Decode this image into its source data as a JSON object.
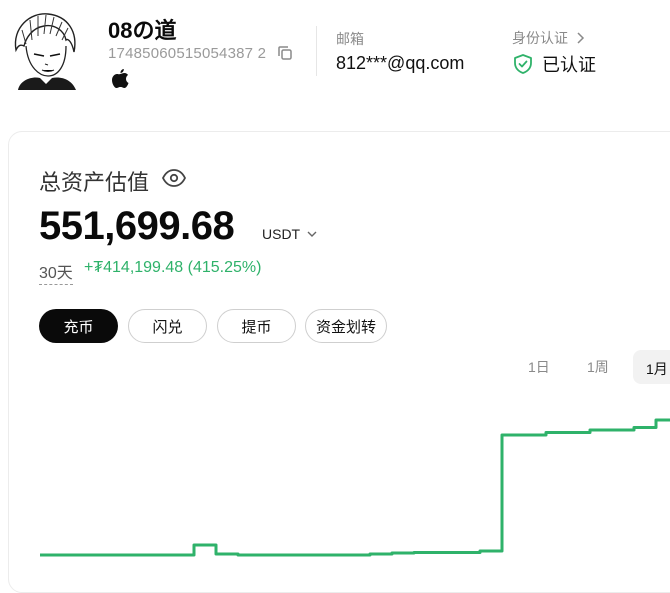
{
  "header": {
    "username": "08の道",
    "uid": "17485060515054387 2",
    "email_label": "邮箱",
    "email_value": "812***@qq.com",
    "kyc_label": "身份认证",
    "kyc_status": "已认证"
  },
  "assets": {
    "title": "总资产估值",
    "total_value": "551,699.68",
    "currency": "USDT",
    "period": "30天",
    "pnl": "+₮414,199.48 (415.25%)"
  },
  "actions": {
    "deposit": "充币",
    "convert": "闪兑",
    "withdraw": "提币",
    "transfer": "资金划转"
  },
  "ranges": {
    "day": "1日",
    "week": "1周",
    "month": "1月"
  },
  "colors": {
    "accent_green": "#2fb26a",
    "primary_button": "#0a0a0a"
  },
  "chart_data": {
    "type": "line",
    "x": [
      0,
      1,
      2,
      3,
      4,
      5,
      6,
      7,
      8,
      9,
      10,
      11,
      12,
      13,
      14,
      15,
      16,
      17,
      18,
      19,
      20,
      21,
      22,
      23,
      24,
      25,
      26,
      27,
      28,
      29,
      30
    ],
    "series": [
      {
        "values": [
          90,
          90,
          90,
          90,
          90,
          90,
          90,
          110,
          92,
          90,
          90,
          90,
          90,
          90,
          90,
          92,
          94,
          95,
          95,
          95,
          98,
          330,
          330,
          335,
          335,
          340,
          340,
          345,
          360,
          360,
          360
        ]
      }
    ],
    "grid": false,
    "legend": "none"
  }
}
